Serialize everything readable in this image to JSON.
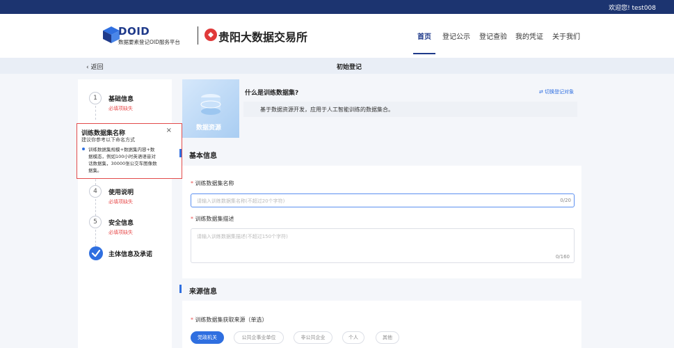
{
  "topbar": {
    "welcome": "欢迎您! test008"
  },
  "header": {
    "doid_title": "DOID",
    "doid_subtitle": "数据要素登记OID服务平台",
    "exchange_name": "贵阳大数据交易所",
    "nav": [
      "首页",
      "登记公示",
      "登记查验",
      "我的凭证",
      "关于我们"
    ],
    "active_nav": "首页"
  },
  "subbar": {
    "back_label": "返回",
    "title": "初始登记"
  },
  "steps": [
    {
      "number": "1",
      "title": "基础信息",
      "warning": "必填项缺失"
    },
    {
      "number": "4",
      "title": "使用说明",
      "warning": "必填项缺失"
    },
    {
      "number": "5",
      "title": "安全信息",
      "warning": "必填项缺失"
    },
    {
      "number": "",
      "title": "主体信息及承诺",
      "warning": ""
    }
  ],
  "tooltip": {
    "title": "训练数据集名称",
    "subtitle": "建议你参考以下命名方式",
    "lines": [
      "训练数据集规模+数据集内容+数",
      "据模态，例如100小时英语语音对",
      "话数据集，30000张公交车图像数",
      "据集。"
    ]
  },
  "intro": {
    "image_label": "数据资源",
    "question": "什么是训练数据集?",
    "description": "基于数据资源开发，应用于人工智能训练的数据集合。",
    "switch_link": "切换登记对象"
  },
  "basic_info": {
    "section_title": "基本信息",
    "name_label": "训练数据集名称",
    "name_placeholder": "请输入训练数据集名称(不超过20个字符)",
    "name_count": "0/20",
    "desc_label": "训练数据集描述",
    "desc_placeholder": "请输入训练数据集描述(不超过150个字符)",
    "desc_count": "0/160"
  },
  "source_info": {
    "section_title": "来源信息",
    "source_label": "训练数据集获取来源（单选）",
    "options": [
      "党政机关",
      "公共企事业单位",
      "非公共企业",
      "个人",
      "其他"
    ],
    "selected": "党政机关"
  },
  "colors": {
    "primary": "#2f6fe0",
    "topbar": "#1c3470",
    "warning": "#e85050"
  }
}
